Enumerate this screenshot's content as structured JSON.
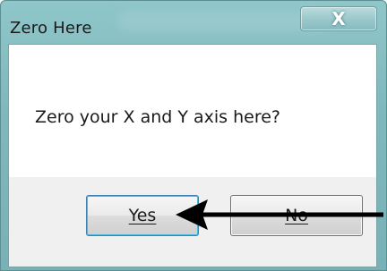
{
  "window": {
    "title": "Zero Here",
    "close_symbol": "X"
  },
  "dialog": {
    "message": "Zero your X and Y axis here?"
  },
  "buttons": {
    "yes_label": "Yes",
    "no_label": "No"
  },
  "annotation": {
    "arrow_icon": "left-pointing-arrow",
    "points_to": "yes-button"
  },
  "colors": {
    "titlebar": "#86bcc0",
    "dialog_body": "#f0f0f0",
    "content_area": "#ffffff",
    "default_button_border": "#3c7fb1"
  }
}
